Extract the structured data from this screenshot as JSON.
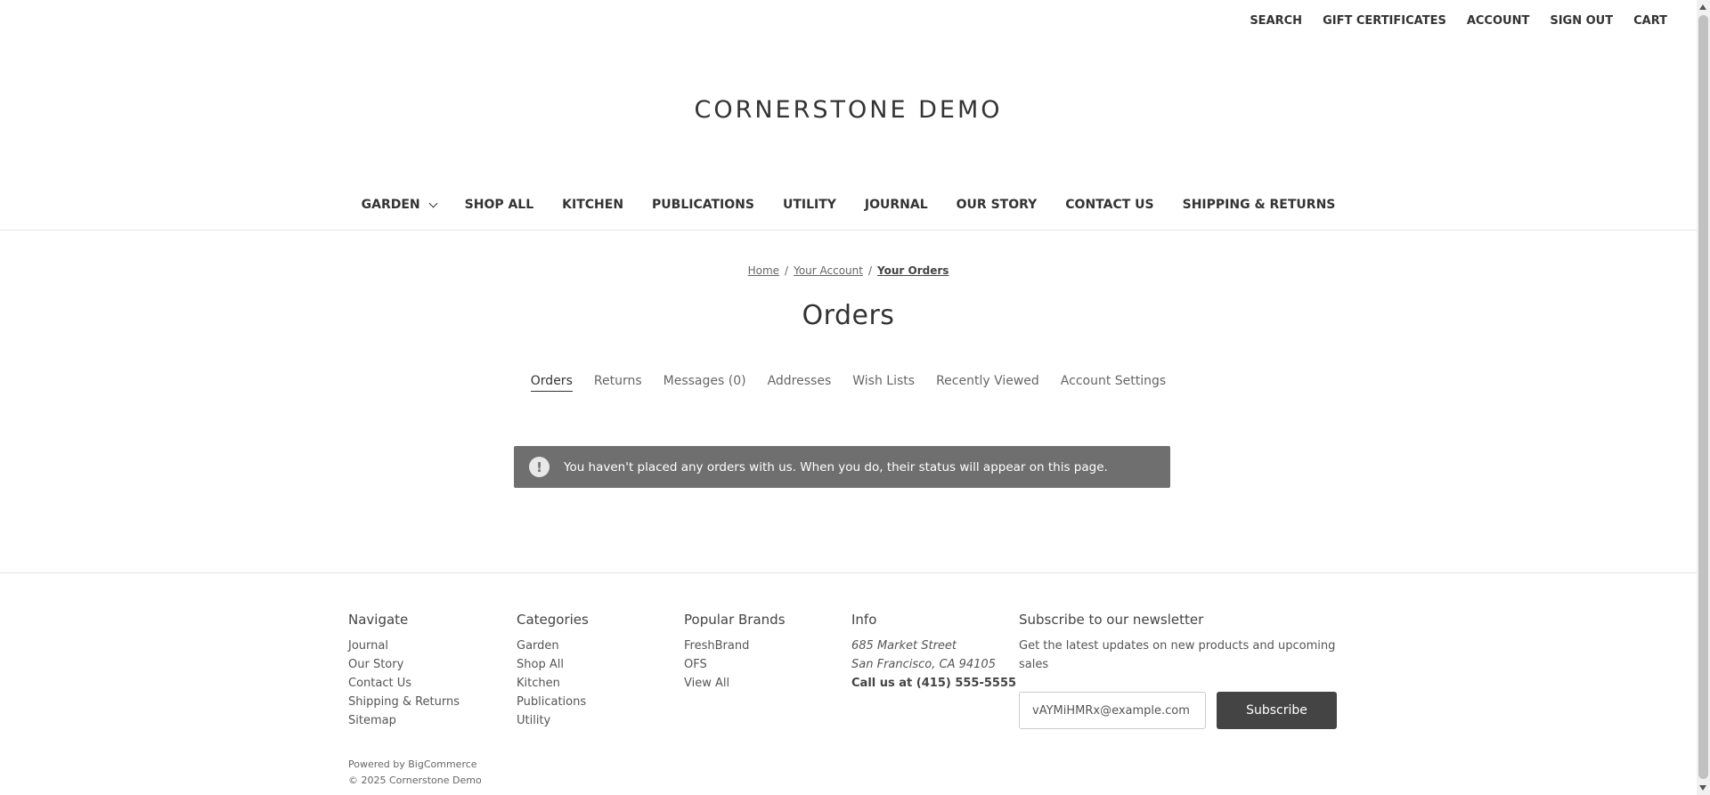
{
  "top_nav": [
    "SEARCH",
    "GIFT CERTIFICATES",
    "ACCOUNT",
    "SIGN OUT",
    "CART"
  ],
  "logo": "CORNERSTONE DEMO",
  "main_nav": [
    "GARDEN",
    "SHOP ALL",
    "KITCHEN",
    "PUBLICATIONS",
    "UTILITY",
    "JOURNAL",
    "OUR STORY",
    "CONTACT US",
    "SHIPPING & RETURNS"
  ],
  "breadcrumb": {
    "home": "Home",
    "account": "Your Account",
    "current": "Your Orders",
    "separator": "/"
  },
  "page_title": "Orders",
  "account_tabs": [
    "Orders",
    "Returns",
    "Messages (0)",
    "Addresses",
    "Wish Lists",
    "Recently Viewed",
    "Account Settings"
  ],
  "alert": {
    "icon": "!",
    "message": "You haven't placed any orders with us. When you do, their status will appear on this page."
  },
  "footer": {
    "navigate": {
      "heading": "Navigate",
      "items": [
        "Journal",
        "Our Story",
        "Contact Us",
        "Shipping & Returns",
        "Sitemap"
      ]
    },
    "categories": {
      "heading": "Categories",
      "items": [
        "Garden",
        "Shop All",
        "Kitchen",
        "Publications",
        "Utility"
      ]
    },
    "brands": {
      "heading": "Popular Brands",
      "items": [
        "FreshBrand",
        "OFS",
        "View All"
      ]
    },
    "info": {
      "heading": "Info",
      "address_line1": "685 Market Street",
      "address_line2": "San Francisco, CA 94105",
      "phone": "Call us at (415) 555-5555"
    },
    "newsletter": {
      "heading": "Subscribe to our newsletter",
      "description": "Get the latest updates on new products and upcoming sales",
      "email_value": "vAYMiHMRx@example.com",
      "button": "Subscribe"
    },
    "powered_by": "Powered by BigCommerce",
    "copyright": "© 2025 Cornerstone Demo"
  },
  "colors": {
    "alert_bg": "#6f6f6f",
    "button_bg": "#444444",
    "text": "#333333"
  }
}
